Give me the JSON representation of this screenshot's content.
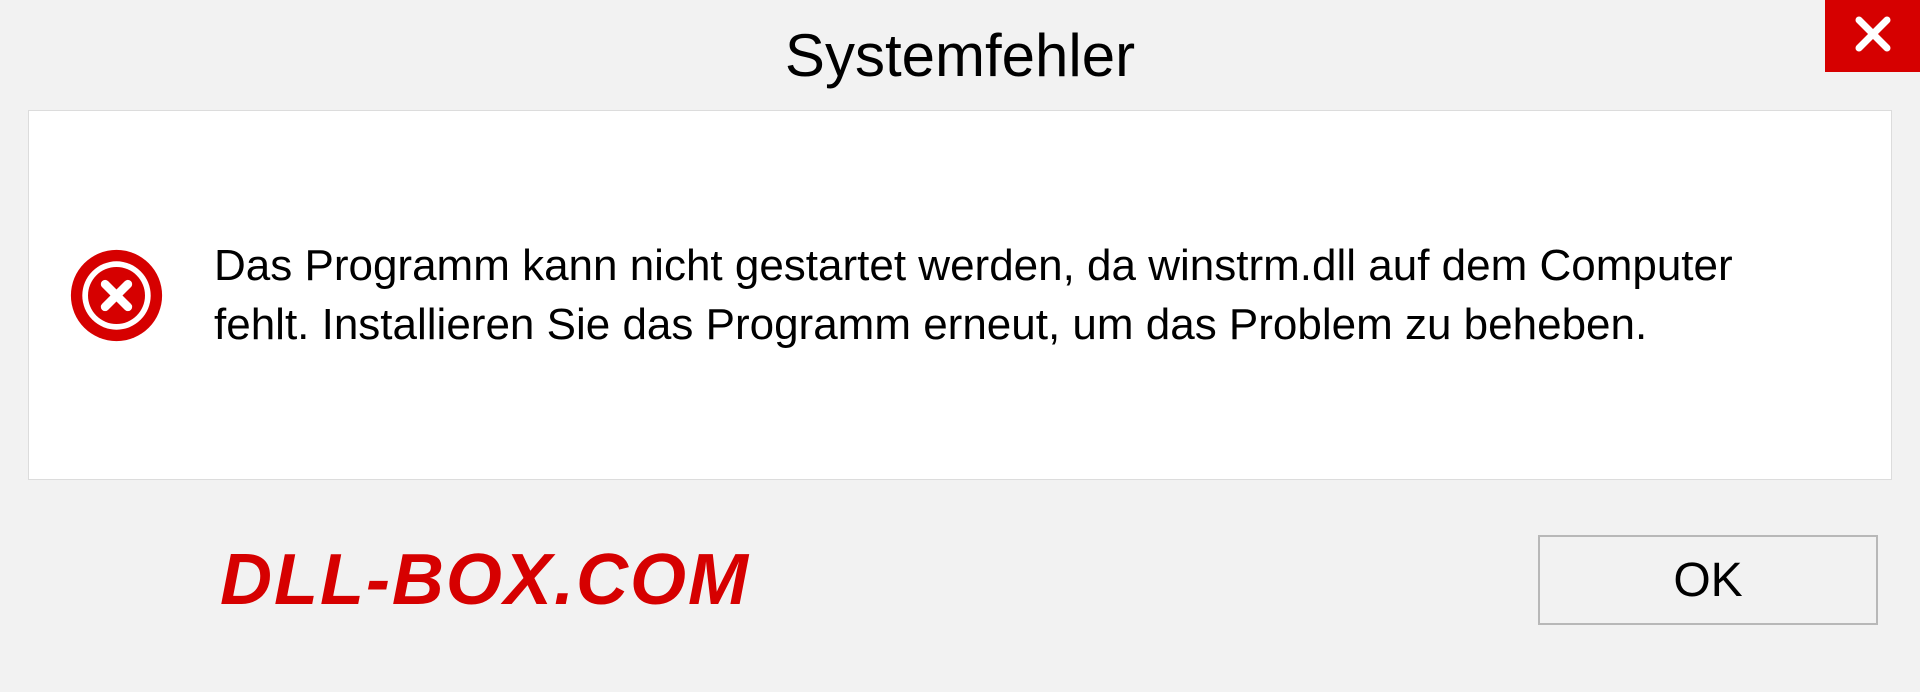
{
  "dialog": {
    "title": "Systemfehler",
    "message": "Das Programm kann nicht gestartet werden, da winstrm.dll auf dem Computer fehlt. Installieren Sie das Programm erneut, um das Problem zu beheben.",
    "ok_label": "OK"
  },
  "watermark": "DLL-BOX.COM"
}
